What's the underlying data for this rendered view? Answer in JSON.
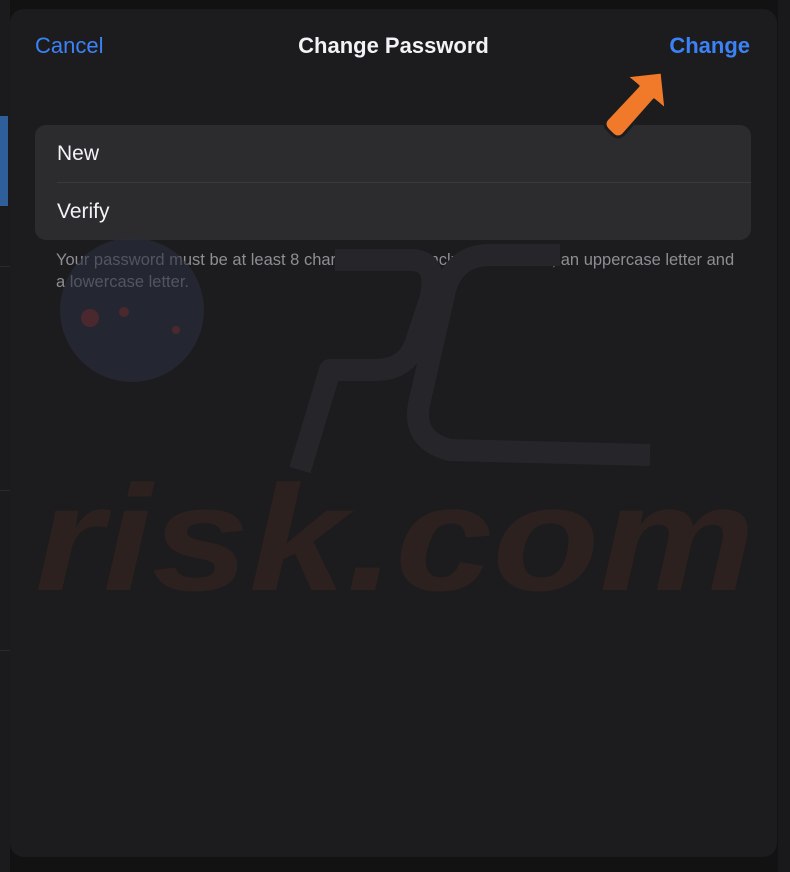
{
  "nav": {
    "cancel_label": "Cancel",
    "title": "Change Password",
    "change_label": "Change"
  },
  "form": {
    "fields": [
      {
        "label": "New",
        "value": ""
      },
      {
        "label": "Verify",
        "value": ""
      }
    ]
  },
  "hint": "Your password must be at least 8 characters long, include a number, an uppercase letter and a lowercase letter.",
  "watermark": {
    "text": "risk.com"
  },
  "annotation": {
    "icon": "arrow-pointer-icon",
    "color": "#f07a2a"
  },
  "colors": {
    "accent": "#3b82f6",
    "sheet_background": "#1c1c1e",
    "group_background": "#2c2c2e",
    "secondary_text": "#8e8e93"
  }
}
